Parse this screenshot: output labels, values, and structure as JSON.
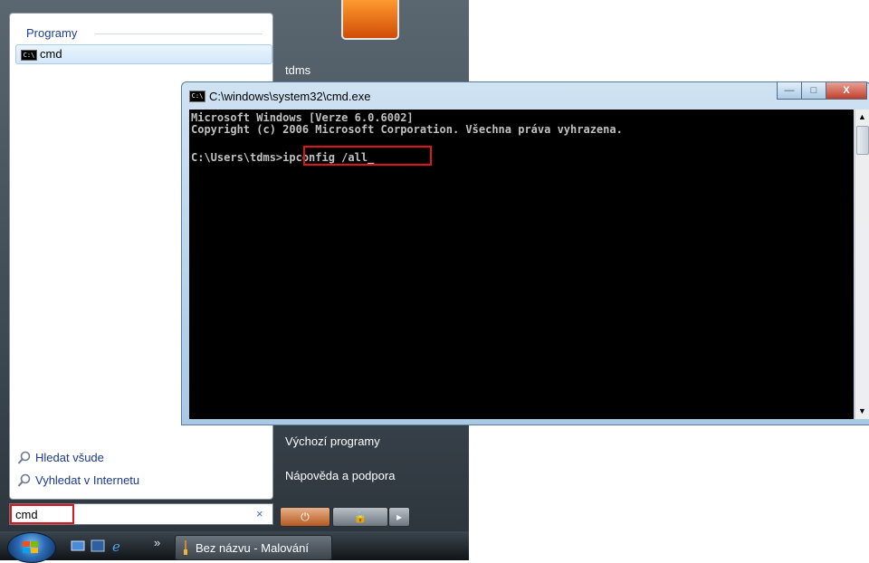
{
  "start_menu": {
    "programs_header": "Programy",
    "program_item": {
      "label": "cmd",
      "icon": "cmd-icon"
    },
    "search_everywhere": "Hledat všude",
    "search_internet": "Vyhledat v Internetu",
    "search_value": "cmd",
    "search_clear": "×",
    "right_pane": {
      "user_name": "tdms",
      "default_programs": "Výchozí programy",
      "help_support": "Nápověda a podpora"
    },
    "power_buttons": {
      "power": "⏻",
      "lock": "🔒",
      "arrow": "▸"
    }
  },
  "cmd_window": {
    "title": "C:\\windows\\system32\\cmd.exe",
    "lines": [
      "Microsoft Windows [Verze 6.0.6002]",
      "Copyright (c) 2006 Microsoft Corporation. Všechna práva vyhrazena.",
      "",
      "C:\\Users\\tdms>ipconfig /all_"
    ],
    "window_buttons": {
      "minimize": "—",
      "maximize": "□",
      "close": "X"
    }
  },
  "taskbar": {
    "chevron": "»",
    "task_label": "Bez názvu - Malování"
  },
  "colors": {
    "highlight": "#e0141b",
    "console_bg": "#000000",
    "console_text": "#c0c0c0"
  }
}
